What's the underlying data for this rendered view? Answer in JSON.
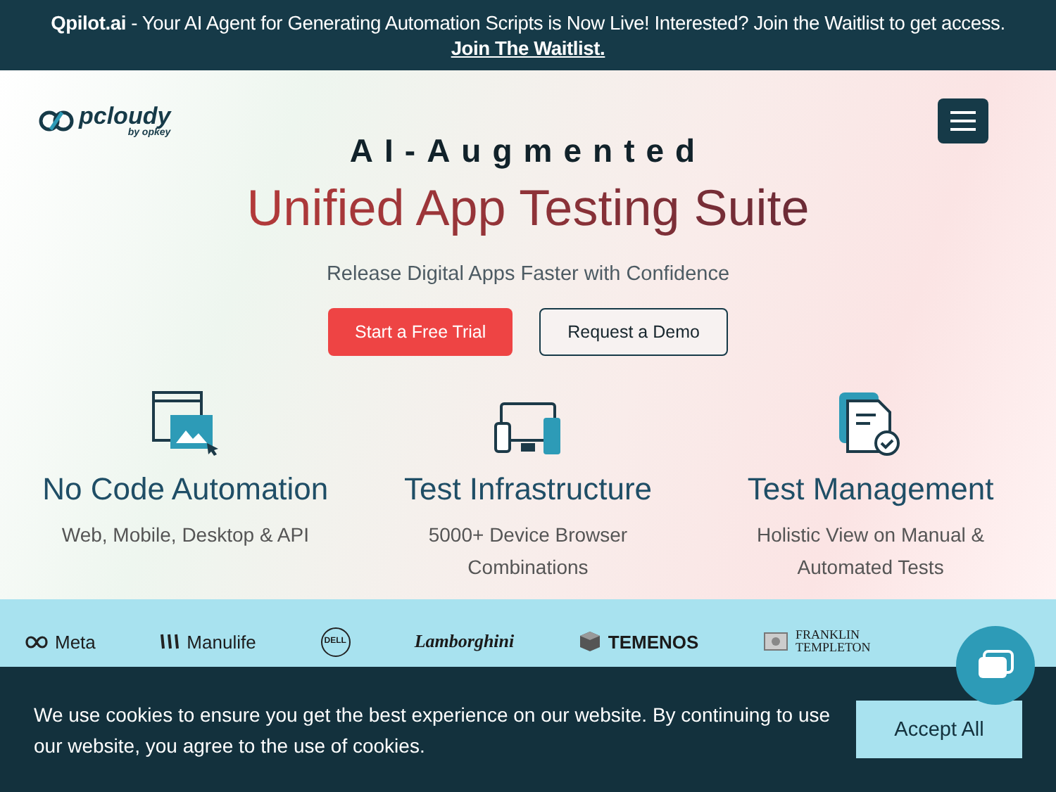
{
  "announcement": {
    "brand": "Qpilot.ai",
    "text": "- Your AI Agent for Generating Automation Scripts is Now Live! Interested? Join the Waitlist to get access.",
    "link": "Join The Waitlist."
  },
  "header": {
    "logo": "pcloudy",
    "logo_sub": "by opkey"
  },
  "hero": {
    "eyebrow": "AI-Augmented",
    "title": "Unified App Testing Suite",
    "subtitle": "Release Digital Apps Faster with Confidence",
    "buttons": [
      {
        "label": "Start a Free Trial",
        "kind": "primary"
      },
      {
        "label": "Request a Demo",
        "kind": "outline"
      }
    ]
  },
  "features": [
    {
      "kind": "automation",
      "title": "No Code Automation",
      "text": "Web, Mobile, Desktop & API"
    },
    {
      "kind": "devices",
      "title": "Test Infrastructure",
      "text": "5000+ Device Browser Combinations"
    },
    {
      "kind": "management",
      "title": "Test Management",
      "text": "Holistic View on Manual & Automated Tests"
    }
  ],
  "clients": [
    {
      "kind": "meta",
      "name": "Meta"
    },
    {
      "kind": "bars",
      "name": "Manulife"
    },
    {
      "kind": "circle",
      "name": "DELL"
    },
    {
      "kind": "script",
      "name": "Lamborghini"
    },
    {
      "kind": "cube",
      "name": "TEMENOS"
    },
    {
      "kind": "serif",
      "name": "FRANKLIN TEMPLETON"
    }
  ],
  "cookie": {
    "text": "We use cookies to ensure you get the best experience on our website. By continuing to use our website, you agree to the use of cookies.",
    "button": "Accept All"
  }
}
